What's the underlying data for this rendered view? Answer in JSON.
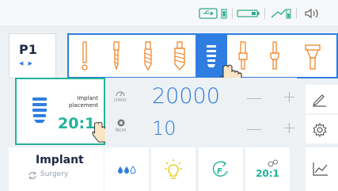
{
  "status_bar": {
    "icons": [
      "usb-icon",
      "battery-icon",
      "foot-pedal-battery-icon",
      "volume-icon"
    ]
  },
  "program": {
    "label": "P1",
    "arrows": "◀ ▶"
  },
  "tools": [
    {
      "name": "probe-tool",
      "selected": false
    },
    {
      "name": "drill-1-tool",
      "selected": false
    },
    {
      "name": "drill-2-tool",
      "selected": false
    },
    {
      "name": "drill-3-tool",
      "selected": false
    },
    {
      "name": "implant-tool",
      "selected": true
    },
    {
      "name": "cover-screw-tool",
      "selected": false
    },
    {
      "name": "healing-abutment-tool",
      "selected": false
    },
    {
      "name": "abutment-tool",
      "selected": false
    }
  ],
  "implant_card": {
    "line1": "Implant",
    "line2": "placement",
    "ratio": "20:1"
  },
  "speed": {
    "unit": "r/min",
    "value": "20000",
    "minus": "—",
    "plus": "+"
  },
  "torque": {
    "unit": "Ncm",
    "value": "10",
    "minus": "—",
    "plus": "+"
  },
  "mode": {
    "title": "Implant",
    "subtitle": "Surgery"
  },
  "bottom": {
    "ratio_label": "20:1"
  },
  "colors": {
    "accent_blue": "#2f7de1",
    "accent_green": "#21b39a",
    "dark_text": "#1e2a46"
  }
}
